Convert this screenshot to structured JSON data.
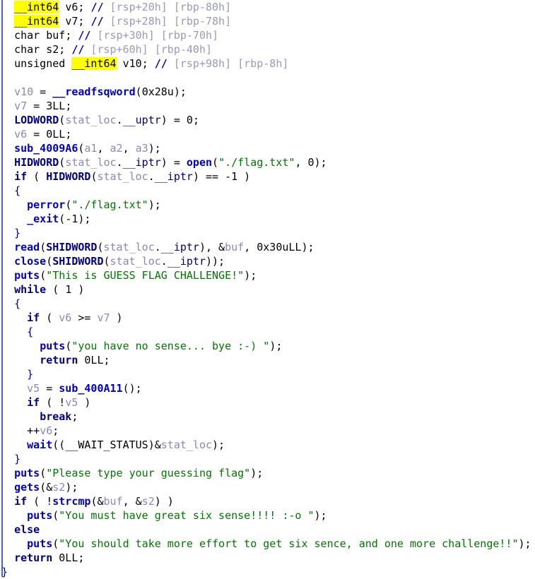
{
  "view": {
    "name": "hex-rays-pseudocode",
    "app": "IDA Pro Hex-Rays Decompiler",
    "background": "#ffffff",
    "gutter_color": "#4a63c8",
    "highlight_color": "#ffff00",
    "colors": {
      "keyword": "#000080",
      "function": "#0000c0",
      "local_variable": "#8888bb",
      "string": "#007700",
      "comment": "#9999bb",
      "comment_marker": "#0000cc",
      "plain": "#000000"
    }
  },
  "lines": [
    {
      "indent": 1,
      "tokens": [
        {
          "t": "__int64",
          "c": "type",
          "hl": true
        },
        {
          "t": " ",
          "c": "plain"
        },
        {
          "t": "v6",
          "c": "plain"
        },
        {
          "t": "; ",
          "c": "plain"
        },
        {
          "t": "//",
          "c": "cmtmark"
        },
        {
          "t": " [rsp+20h] [rbp-80h]",
          "c": "comment"
        }
      ]
    },
    {
      "indent": 1,
      "tokens": [
        {
          "t": "__int64",
          "c": "type",
          "hl": true
        },
        {
          "t": " ",
          "c": "plain"
        },
        {
          "t": "v7",
          "c": "plain"
        },
        {
          "t": "; ",
          "c": "plain"
        },
        {
          "t": "//",
          "c": "cmtmark"
        },
        {
          "t": " [rsp+28h] [rbp-78h]",
          "c": "comment"
        }
      ]
    },
    {
      "indent": 1,
      "tokens": [
        {
          "t": "char",
          "c": "type"
        },
        {
          "t": " ",
          "c": "plain"
        },
        {
          "t": "buf",
          "c": "plain"
        },
        {
          "t": "; ",
          "c": "plain"
        },
        {
          "t": "//",
          "c": "cmtmark"
        },
        {
          "t": " [rsp+30h] [rbp-70h]",
          "c": "comment"
        }
      ]
    },
    {
      "indent": 1,
      "tokens": [
        {
          "t": "char",
          "c": "type"
        },
        {
          "t": " ",
          "c": "plain"
        },
        {
          "t": "s2",
          "c": "plain"
        },
        {
          "t": "; ",
          "c": "plain"
        },
        {
          "t": "//",
          "c": "cmtmark"
        },
        {
          "t": " [rsp+60h] [rbp-40h]",
          "c": "comment"
        }
      ]
    },
    {
      "indent": 1,
      "tokens": [
        {
          "t": "unsigned ",
          "c": "type"
        },
        {
          "t": "__int64",
          "c": "type",
          "hl": true
        },
        {
          "t": " ",
          "c": "plain"
        },
        {
          "t": "v10",
          "c": "plain"
        },
        {
          "t": "; ",
          "c": "plain"
        },
        {
          "t": "//",
          "c": "cmtmark"
        },
        {
          "t": " [rsp+98h] [rbp-8h]",
          "c": "comment"
        }
      ]
    },
    {
      "indent": 0,
      "tokens": []
    },
    {
      "indent": 1,
      "tokens": [
        {
          "t": "v10",
          "c": "local"
        },
        {
          "t": " = ",
          "c": "plain"
        },
        {
          "t": "__readfsqword",
          "c": "func"
        },
        {
          "t": "(",
          "c": "plain"
        },
        {
          "t": "0x28u",
          "c": "number"
        },
        {
          "t": ");",
          "c": "plain"
        }
      ]
    },
    {
      "indent": 1,
      "tokens": [
        {
          "t": "v7",
          "c": "local"
        },
        {
          "t": " = ",
          "c": "plain"
        },
        {
          "t": "3LL",
          "c": "number"
        },
        {
          "t": ";",
          "c": "plain"
        }
      ]
    },
    {
      "indent": 1,
      "tokens": [
        {
          "t": "LODWORD",
          "c": "macro"
        },
        {
          "t": "(",
          "c": "plain"
        },
        {
          "t": "stat_loc",
          "c": "local"
        },
        {
          "t": ".",
          "c": "plain"
        },
        {
          "t": "__uptr",
          "c": "member"
        },
        {
          "t": ") = ",
          "c": "plain"
        },
        {
          "t": "0",
          "c": "number"
        },
        {
          "t": ";",
          "c": "plain"
        }
      ]
    },
    {
      "indent": 1,
      "tokens": [
        {
          "t": "v6",
          "c": "local"
        },
        {
          "t": " = ",
          "c": "plain"
        },
        {
          "t": "0LL",
          "c": "number"
        },
        {
          "t": ";",
          "c": "plain"
        }
      ]
    },
    {
      "indent": 1,
      "tokens": [
        {
          "t": "sub_4009A6",
          "c": "func"
        },
        {
          "t": "(",
          "c": "plain"
        },
        {
          "t": "a1",
          "c": "local"
        },
        {
          "t": ", ",
          "c": "plain"
        },
        {
          "t": "a2",
          "c": "local"
        },
        {
          "t": ", ",
          "c": "plain"
        },
        {
          "t": "a3",
          "c": "local"
        },
        {
          "t": ");",
          "c": "plain"
        }
      ]
    },
    {
      "indent": 1,
      "tokens": [
        {
          "t": "HIDWORD",
          "c": "macro"
        },
        {
          "t": "(",
          "c": "plain"
        },
        {
          "t": "stat_loc",
          "c": "local"
        },
        {
          "t": ".",
          "c": "plain"
        },
        {
          "t": "__iptr",
          "c": "member"
        },
        {
          "t": ") = ",
          "c": "plain"
        },
        {
          "t": "open",
          "c": "func"
        },
        {
          "t": "(",
          "c": "plain"
        },
        {
          "t": "\"./flag.txt\"",
          "c": "string"
        },
        {
          "t": ", ",
          "c": "plain"
        },
        {
          "t": "0",
          "c": "number"
        },
        {
          "t": ");",
          "c": "plain"
        }
      ]
    },
    {
      "indent": 1,
      "tokens": [
        {
          "t": "if",
          "c": "keyword"
        },
        {
          "t": " ( ",
          "c": "plain"
        },
        {
          "t": "HIDWORD",
          "c": "macro"
        },
        {
          "t": "(",
          "c": "plain"
        },
        {
          "t": "stat_loc",
          "c": "local"
        },
        {
          "t": ".",
          "c": "plain"
        },
        {
          "t": "__iptr",
          "c": "member"
        },
        {
          "t": ") == ",
          "c": "plain"
        },
        {
          "t": "-1",
          "c": "number"
        },
        {
          "t": " )",
          "c": "plain"
        }
      ]
    },
    {
      "indent": 1,
      "tokens": [
        {
          "t": "{",
          "c": "brace"
        }
      ]
    },
    {
      "indent": 2,
      "tokens": [
        {
          "t": "perror",
          "c": "func"
        },
        {
          "t": "(",
          "c": "plain"
        },
        {
          "t": "\"./flag.txt\"",
          "c": "string"
        },
        {
          "t": ");",
          "c": "plain"
        }
      ]
    },
    {
      "indent": 2,
      "tokens": [
        {
          "t": "_exit",
          "c": "func"
        },
        {
          "t": "(",
          "c": "plain"
        },
        {
          "t": "-1",
          "c": "number"
        },
        {
          "t": ");",
          "c": "plain"
        }
      ]
    },
    {
      "indent": 1,
      "tokens": [
        {
          "t": "}",
          "c": "brace"
        }
      ]
    },
    {
      "indent": 1,
      "tokens": [
        {
          "t": "read",
          "c": "func"
        },
        {
          "t": "(",
          "c": "plain"
        },
        {
          "t": "SHIDWORD",
          "c": "macro"
        },
        {
          "t": "(",
          "c": "plain"
        },
        {
          "t": "stat_loc",
          "c": "local"
        },
        {
          "t": ".",
          "c": "plain"
        },
        {
          "t": "__iptr",
          "c": "member"
        },
        {
          "t": "), &",
          "c": "plain"
        },
        {
          "t": "buf",
          "c": "local"
        },
        {
          "t": ", ",
          "c": "plain"
        },
        {
          "t": "0x30uLL",
          "c": "number"
        },
        {
          "t": ");",
          "c": "plain"
        }
      ]
    },
    {
      "indent": 1,
      "tokens": [
        {
          "t": "close",
          "c": "func"
        },
        {
          "t": "(",
          "c": "plain"
        },
        {
          "t": "SHIDWORD",
          "c": "macro"
        },
        {
          "t": "(",
          "c": "plain"
        },
        {
          "t": "stat_loc",
          "c": "local"
        },
        {
          "t": ".",
          "c": "plain"
        },
        {
          "t": "__iptr",
          "c": "member"
        },
        {
          "t": "));",
          "c": "plain"
        }
      ]
    },
    {
      "indent": 1,
      "tokens": [
        {
          "t": "puts",
          "c": "func"
        },
        {
          "t": "(",
          "c": "plain"
        },
        {
          "t": "\"This is GUESS FLAG CHALLENGE!\"",
          "c": "string"
        },
        {
          "t": ");",
          "c": "plain"
        }
      ]
    },
    {
      "indent": 1,
      "tokens": [
        {
          "t": "while",
          "c": "keyword"
        },
        {
          "t": " ( ",
          "c": "plain"
        },
        {
          "t": "1",
          "c": "number"
        },
        {
          "t": " )",
          "c": "plain"
        }
      ]
    },
    {
      "indent": 1,
      "tokens": [
        {
          "t": "{",
          "c": "brace"
        }
      ]
    },
    {
      "indent": 2,
      "tokens": [
        {
          "t": "if",
          "c": "keyword"
        },
        {
          "t": " ( ",
          "c": "plain"
        },
        {
          "t": "v6",
          "c": "local"
        },
        {
          "t": " >= ",
          "c": "plain"
        },
        {
          "t": "v7",
          "c": "local"
        },
        {
          "t": " )",
          "c": "plain"
        }
      ]
    },
    {
      "indent": 2,
      "tokens": [
        {
          "t": "{",
          "c": "brace"
        }
      ]
    },
    {
      "indent": 3,
      "tokens": [
        {
          "t": "puts",
          "c": "func"
        },
        {
          "t": "(",
          "c": "plain"
        },
        {
          "t": "\"you have no sense... bye :-) \"",
          "c": "string"
        },
        {
          "t": ");",
          "c": "plain"
        }
      ]
    },
    {
      "indent": 3,
      "tokens": [
        {
          "t": "return",
          "c": "keyword"
        },
        {
          "t": " ",
          "c": "plain"
        },
        {
          "t": "0LL",
          "c": "number"
        },
        {
          "t": ";",
          "c": "plain"
        }
      ]
    },
    {
      "indent": 2,
      "tokens": [
        {
          "t": "}",
          "c": "brace"
        }
      ]
    },
    {
      "indent": 2,
      "tokens": [
        {
          "t": "v5",
          "c": "local"
        },
        {
          "t": " = ",
          "c": "plain"
        },
        {
          "t": "sub_400A11",
          "c": "func"
        },
        {
          "t": "();",
          "c": "plain"
        }
      ]
    },
    {
      "indent": 2,
      "tokens": [
        {
          "t": "if",
          "c": "keyword"
        },
        {
          "t": " ( !",
          "c": "plain"
        },
        {
          "t": "v5",
          "c": "local"
        },
        {
          "t": " )",
          "c": "plain"
        }
      ]
    },
    {
      "indent": 3,
      "tokens": [
        {
          "t": "break",
          "c": "keyword"
        },
        {
          "t": ";",
          "c": "plain"
        }
      ]
    },
    {
      "indent": 2,
      "tokens": [
        {
          "t": "++",
          "c": "plain"
        },
        {
          "t": "v6",
          "c": "local"
        },
        {
          "t": ";",
          "c": "plain"
        }
      ]
    },
    {
      "indent": 2,
      "tokens": [
        {
          "t": "wait",
          "c": "func"
        },
        {
          "t": "((",
          "c": "plain"
        },
        {
          "t": "__WAIT_STATUS",
          "c": "type"
        },
        {
          "t": ")&",
          "c": "plain"
        },
        {
          "t": "stat_loc",
          "c": "local"
        },
        {
          "t": ");",
          "c": "plain"
        }
      ]
    },
    {
      "indent": 1,
      "tokens": [
        {
          "t": "}",
          "c": "brace"
        }
      ]
    },
    {
      "indent": 1,
      "tokens": [
        {
          "t": "puts",
          "c": "func"
        },
        {
          "t": "(",
          "c": "plain"
        },
        {
          "t": "\"Please type your guessing flag\"",
          "c": "string"
        },
        {
          "t": ");",
          "c": "plain"
        }
      ]
    },
    {
      "indent": 1,
      "tokens": [
        {
          "t": "gets",
          "c": "func"
        },
        {
          "t": "(&",
          "c": "plain"
        },
        {
          "t": "s2",
          "c": "local"
        },
        {
          "t": ");",
          "c": "plain"
        }
      ]
    },
    {
      "indent": 1,
      "tokens": [
        {
          "t": "if",
          "c": "keyword"
        },
        {
          "t": " ( !",
          "c": "plain"
        },
        {
          "t": "strcmp",
          "c": "func"
        },
        {
          "t": "(&",
          "c": "plain"
        },
        {
          "t": "buf",
          "c": "local"
        },
        {
          "t": ", &",
          "c": "plain"
        },
        {
          "t": "s2",
          "c": "local"
        },
        {
          "t": ") )",
          "c": "plain"
        }
      ]
    },
    {
      "indent": 2,
      "tokens": [
        {
          "t": "puts",
          "c": "func"
        },
        {
          "t": "(",
          "c": "plain"
        },
        {
          "t": "\"You must have great six sense!!!! :-o \"",
          "c": "string"
        },
        {
          "t": ");",
          "c": "plain"
        }
      ]
    },
    {
      "indent": 1,
      "tokens": [
        {
          "t": "else",
          "c": "keyword"
        }
      ]
    },
    {
      "indent": 2,
      "tokens": [
        {
          "t": "puts",
          "c": "func"
        },
        {
          "t": "(",
          "c": "plain"
        },
        {
          "t": "\"You should take more effort to get six sence, and one more challenge!!\"",
          "c": "string"
        },
        {
          "t": ");",
          "c": "plain"
        }
      ]
    },
    {
      "indent": 1,
      "tokens": [
        {
          "t": "return",
          "c": "keyword"
        },
        {
          "t": " ",
          "c": "plain"
        },
        {
          "t": "0LL",
          "c": "number"
        },
        {
          "t": ";",
          "c": "plain"
        }
      ]
    },
    {
      "indent": 0,
      "tokens": [
        {
          "t": "}",
          "c": "brace"
        }
      ]
    }
  ]
}
